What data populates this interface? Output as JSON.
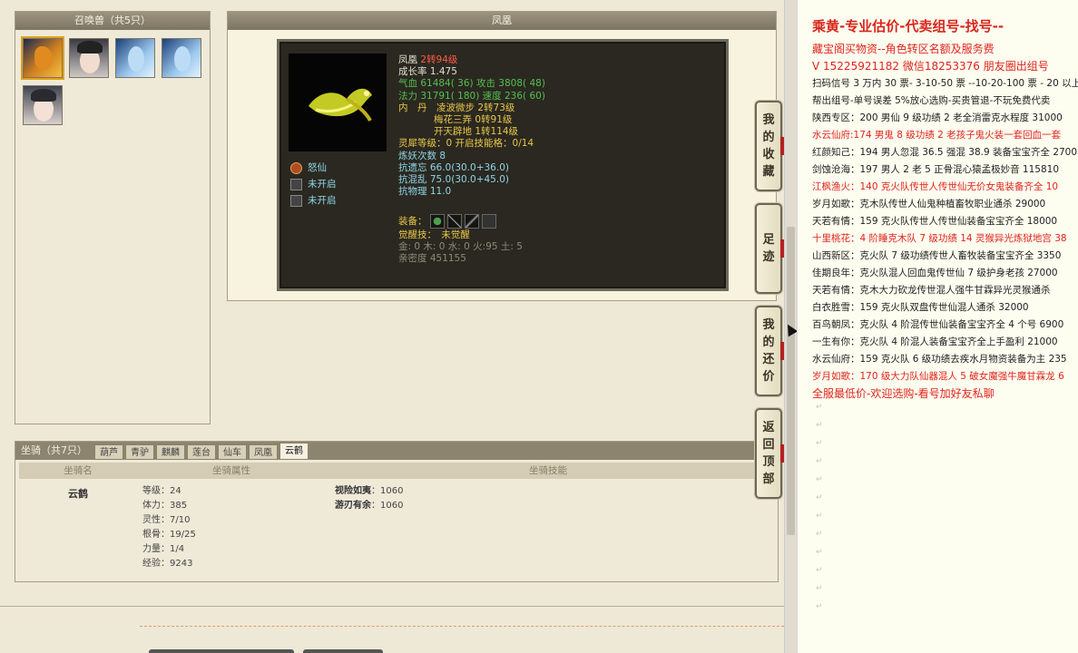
{
  "pets_panel": {
    "title": "召唤兽（共5只）"
  },
  "detail": {
    "title": "凤凰",
    "name": "凤凰",
    "level": "2转94级",
    "growth": "成长率 1.475",
    "hp_line": "气血 61484( 36) 攻击 3808( 48)",
    "mp_line": "法力 31791( 180) 速度 236( 60)",
    "neidan_label": "内　丹",
    "neidan_1": "凌波微步 2转73级",
    "neidan_2": "梅花三弄 0转91级",
    "neidan_3": "开天辟地 1转114级",
    "lingxi": "灵犀等级：0 开启技能格：0/14",
    "lianyao": "炼妖次数 8",
    "kang_yiwang": "抗遗忘 66.0(30.0+36.0)",
    "kang_hunluan": "抗混乱 75.0(30.0+45.0)",
    "kang_wuli": "抗物理 11.0",
    "equip_label": "装备：",
    "juexing": "觉醒技：　未觉醒",
    "elements": "金: 0 木: 0 水: 0 火:95 土: 5",
    "qinmi": "亲密度 451155",
    "skills": [
      {
        "name": "怒仙",
        "on": true
      },
      {
        "name": "未开启",
        "on": false
      },
      {
        "name": "未开启",
        "on": false
      }
    ]
  },
  "mounts": {
    "title": "坐骑（共7只）",
    "tabs": [
      "葫芦",
      "青驴",
      "麒麟",
      "莲台",
      "仙车",
      "凤凰",
      "云鹤"
    ],
    "active_tab": "云鹤",
    "headers": [
      "坐骑名",
      "坐骑属性",
      "坐骑技能"
    ],
    "name": "云鹤",
    "attrs": [
      "等级：24",
      "体力：385",
      "灵性：7/10",
      "根骨：19/25",
      "力量：1/4",
      "经验：9243"
    ],
    "skills": [
      {
        "name": "视险如夷",
        "value": "：1060"
      },
      {
        "name": "游刃有余",
        "value": "：1060"
      }
    ]
  },
  "side_buttons": [
    {
      "label": [
        "我",
        "的",
        "收",
        "藏"
      ]
    },
    {
      "label": [
        "足",
        "迹"
      ]
    },
    {
      "label": [
        "我",
        "的",
        "还",
        "价"
      ]
    },
    {
      "label": [
        "返",
        "回",
        "顶",
        "部"
      ]
    }
  ],
  "notes": {
    "title": "乘黄-专业估价-代卖组号-找号--",
    "line_red1": "藏宝阁买物资--角色转区名额及服务费",
    "line_red2": "V 15225921182 微信18253376 朋友圈出组号",
    "lines": [
      {
        "text": "扫码信号 3 万内 30 票- 3-10-50 票  --10-20-100 票 - 20 以上 1",
        "red": false
      },
      {
        "text": "帮出组号-单号误差 5%放心选购-买贵管退-不玩免费代卖",
        "red": false
      },
      {
        "text": "陕西专区：200 男仙 9 级功绩 2 老全消雷克水程度 31000",
        "red": false
      },
      {
        "text": "水云仙府:174 男鬼 8 级功绩 2 老孩子鬼火装一套回血一套",
        "red": true
      },
      {
        "text": "红颜知己：194 男人忽混 36.5 强混 38.9 装备宝宝齐全 2700",
        "red": false
      },
      {
        "text": "剑蚀沧海：197 男人 2 老 5 正骨混心猿孟极妙音 115810",
        "red": false
      },
      {
        "text": "江枫渔火：140 克火队传世人传世仙无价女鬼装备齐全 10",
        "red": true
      },
      {
        "text": "岁月如歌：克木队传世人仙鬼种植畜牧职业通杀 29000",
        "red": false
      },
      {
        "text": "天若有情：159 克火队传世人传世仙装备宝宝齐全 18000",
        "red": false
      },
      {
        "text": "十里桃花：4 阶睡克木队 7 级功绩 14 灵猴异光炼狱地宫 38",
        "red": true
      },
      {
        "text": "山西新区：克火队 7 级功绩传世人畜牧装备宝宝齐全 3350",
        "red": false
      },
      {
        "text": "佳期良年：克火队混人回血鬼传世仙 7 级护身老孩 27000",
        "red": false
      },
      {
        "text": "天若有情：克木大力砍龙传世混人强牛甘霖异光灵猴通杀",
        "red": false
      },
      {
        "text": "白衣胜雪：159 克火队双盘传世仙混人通杀 32000",
        "red": false
      },
      {
        "text": "百鸟朝凤：克火队 4 阶混传世仙装备宝宝齐全 4 个号 6900",
        "red": false
      },
      {
        "text": "一生有你：克火队 4 阶混人装备宝宝齐全上手盈利 21000",
        "red": false
      },
      {
        "text": "水云仙府：159 克火队 6 级功绩去疾水月物资装备为主 235",
        "red": false
      },
      {
        "text": "岁月如歌：170 级大力队仙器混人 5 破女魔强牛魔甘霖龙 6",
        "red": true
      }
    ],
    "footer": "全服最低价-欢迎选购-看号加好友私聊"
  }
}
